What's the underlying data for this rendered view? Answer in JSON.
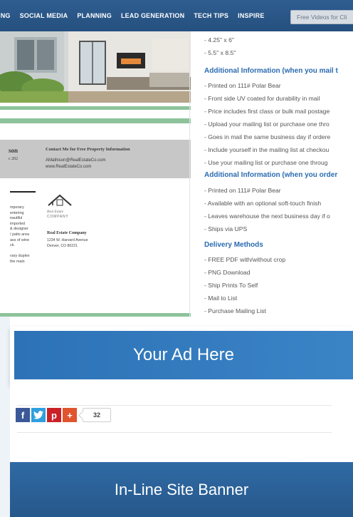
{
  "nav": {
    "items": [
      "ING",
      "SOCIAL MEDIA",
      "PLANNING",
      "LEAD GENERATION",
      "TECH TIPS",
      "INSPIRE"
    ],
    "videos_button": "Free Videos for Cli"
  },
  "preview": {
    "agent_name": "son",
    "agent_suite": "c 202",
    "contact_title": "Contact Me for Free Property Information",
    "contact_email": "AMathison@RealEstateCo.com",
    "contact_web": "www.RealEstateCo.com",
    "body_lines": [
      "mporary",
      "entering",
      "eautiful",
      "imported",
      "& designer",
      "/ patio area",
      "ass of wine",
      "ck.",
      "",
      "vary duplex",
      "the main"
    ],
    "logo_text": "Real Estate COMPANY",
    "company_name": "Real Estate Company",
    "company_address_1": "1234 W. Harvard Avenue",
    "company_address_2": "Denver, CO 80221"
  },
  "details": {
    "sizes": [
      "- 4.25\" x 6\"",
      "- 5.5\" x 8.5\""
    ],
    "heading_mail": "Additional Information (when you mail t",
    "mail_items": [
      "- Printed on 111# Polar Bear",
      "- Front side UV coated for durability in mail",
      "- Price includes first class or bulk mail postage",
      "- Upload your mailing list or purchase one thro",
      "- Goes in mail the same business day if ordere",
      "- Include yourself in the mailing list at checkou",
      "- Use your mailing list or purchase one throug"
    ],
    "heading_order": "Additional Information (when you order",
    "order_items": [
      "- Printed on 111# Polar Bear",
      "- Available with an optional soft-touch finish",
      "- Leaves warehouse the next business day if o",
      "- Ships via UPS"
    ],
    "heading_delivery": "Delivery Methods",
    "delivery_items": [
      "- FREE PDF with/without crop",
      "- PNG Download",
      "- Ship Prints To Self",
      "- Mail to List",
      "- Purchase Mailing List"
    ]
  },
  "ad_banner": {
    "text": "Your Ad Here"
  },
  "share": {
    "buttons": [
      {
        "icon": "facebook-icon",
        "glyph": "f",
        "color": "#3b5998"
      },
      {
        "icon": "twitter-icon",
        "glyph": "t",
        "color": "#2f9fe0"
      },
      {
        "icon": "pinterest-icon",
        "glyph": "p",
        "color": "#cb2027"
      },
      {
        "icon": "plus-icon",
        "glyph": "+",
        "color": "#e0542e"
      }
    ],
    "count": "32"
  },
  "bottom_banner": {
    "text": "In-Line Site Banner"
  }
}
